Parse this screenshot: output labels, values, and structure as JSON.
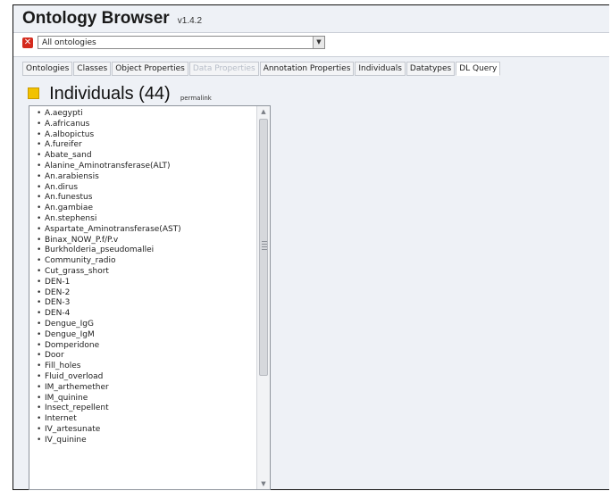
{
  "header": {
    "title": "Ontology Browser",
    "version": "v1.4.2"
  },
  "ontology_select": {
    "value": "All ontologies",
    "close_icon": "close-icon",
    "close_color": "#d42b1e"
  },
  "tabs": [
    {
      "label": "Ontologies",
      "state": "normal"
    },
    {
      "label": "Classes",
      "state": "normal"
    },
    {
      "label": "Object Properties",
      "state": "normal"
    },
    {
      "label": "Data Properties",
      "state": "disabled"
    },
    {
      "label": "Annotation Properties",
      "state": "normal"
    },
    {
      "label": "Individuals",
      "state": "normal"
    },
    {
      "label": "Datatypes",
      "state": "normal"
    },
    {
      "label": "DL Query",
      "state": "active"
    }
  ],
  "section": {
    "title": "Individuals (44)",
    "permalink": "permalink",
    "icon": "folder-icon",
    "icon_color": "#f2c200"
  },
  "individuals": [
    "A.aegypti",
    "A.africanus",
    "A.albopictus",
    "A.fureifer",
    "Abate_sand",
    "Alanine_Aminotransferase(ALT)",
    "An.arabiensis",
    "An.dirus",
    "An.funestus",
    "An.gambiae",
    "An.stephensi",
    "Aspartate_Aminotransferase(AST)",
    "Binax_NOW_P.f/P.v",
    "Burkholderia_pseudomallei",
    "Community_radio",
    "Cut_grass_short",
    "DEN-1",
    "DEN-2",
    "DEN-3",
    "DEN-4",
    "Dengue_IgG",
    "Dengue_IgM",
    "Domperidone",
    "Door",
    "Fill_holes",
    "Fluid_overload",
    "IM_arthemether",
    "IM_quinine",
    "Insect_repellent",
    "Internet",
    "IV_artesunate",
    "IV_quinine"
  ]
}
